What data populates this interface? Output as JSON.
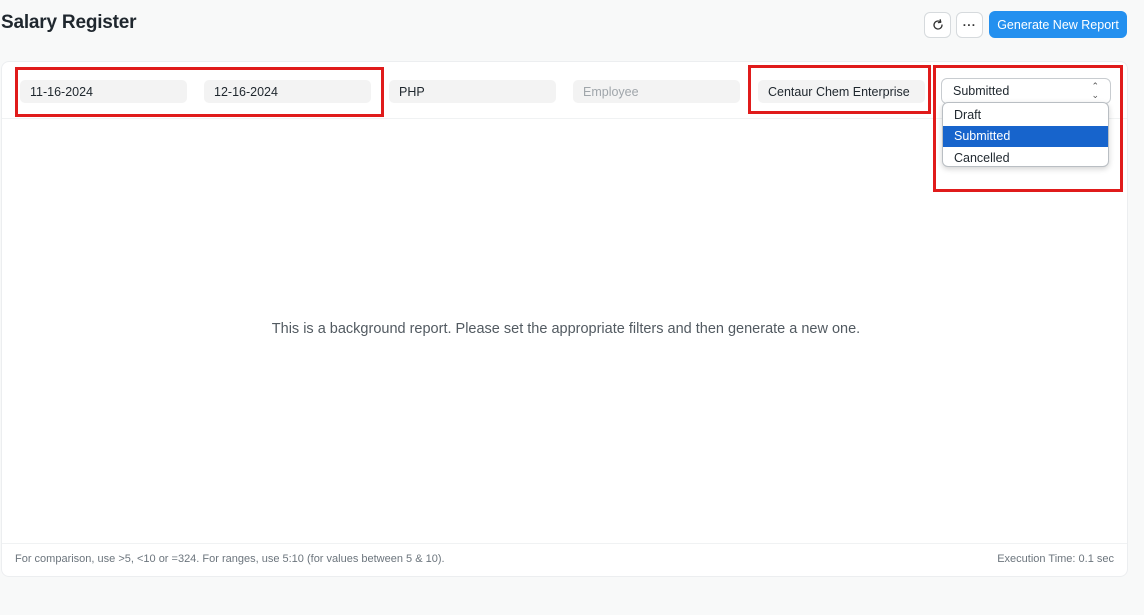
{
  "page": {
    "title": "Salary Register",
    "refresh_icon": "refresh-icon",
    "more_icon": "ellipsis-icon",
    "more_label": "···",
    "generate_button": "Generate New Report"
  },
  "filters": {
    "from_date": "11-16-2024",
    "to_date": "12-16-2024",
    "currency": "PHP",
    "employee_placeholder": "Employee",
    "company": "Centaur Chem Enterprise",
    "docstatus": {
      "selected": "Submitted",
      "options": [
        "Draft",
        "Submitted",
        "Cancelled"
      ]
    }
  },
  "main": {
    "empty_message": "This is a background report. Please set the appropriate filters and then generate a new one."
  },
  "footer": {
    "hint": "For comparison, use >5, <10 or =324. For ranges, use 5:10 (for values between 5 & 10).",
    "execution_time": "Execution Time: 0.1 sec"
  },
  "colors": {
    "primary": "#2490ef",
    "highlight": "#e01b1b",
    "selected_option": "#1764cc"
  }
}
